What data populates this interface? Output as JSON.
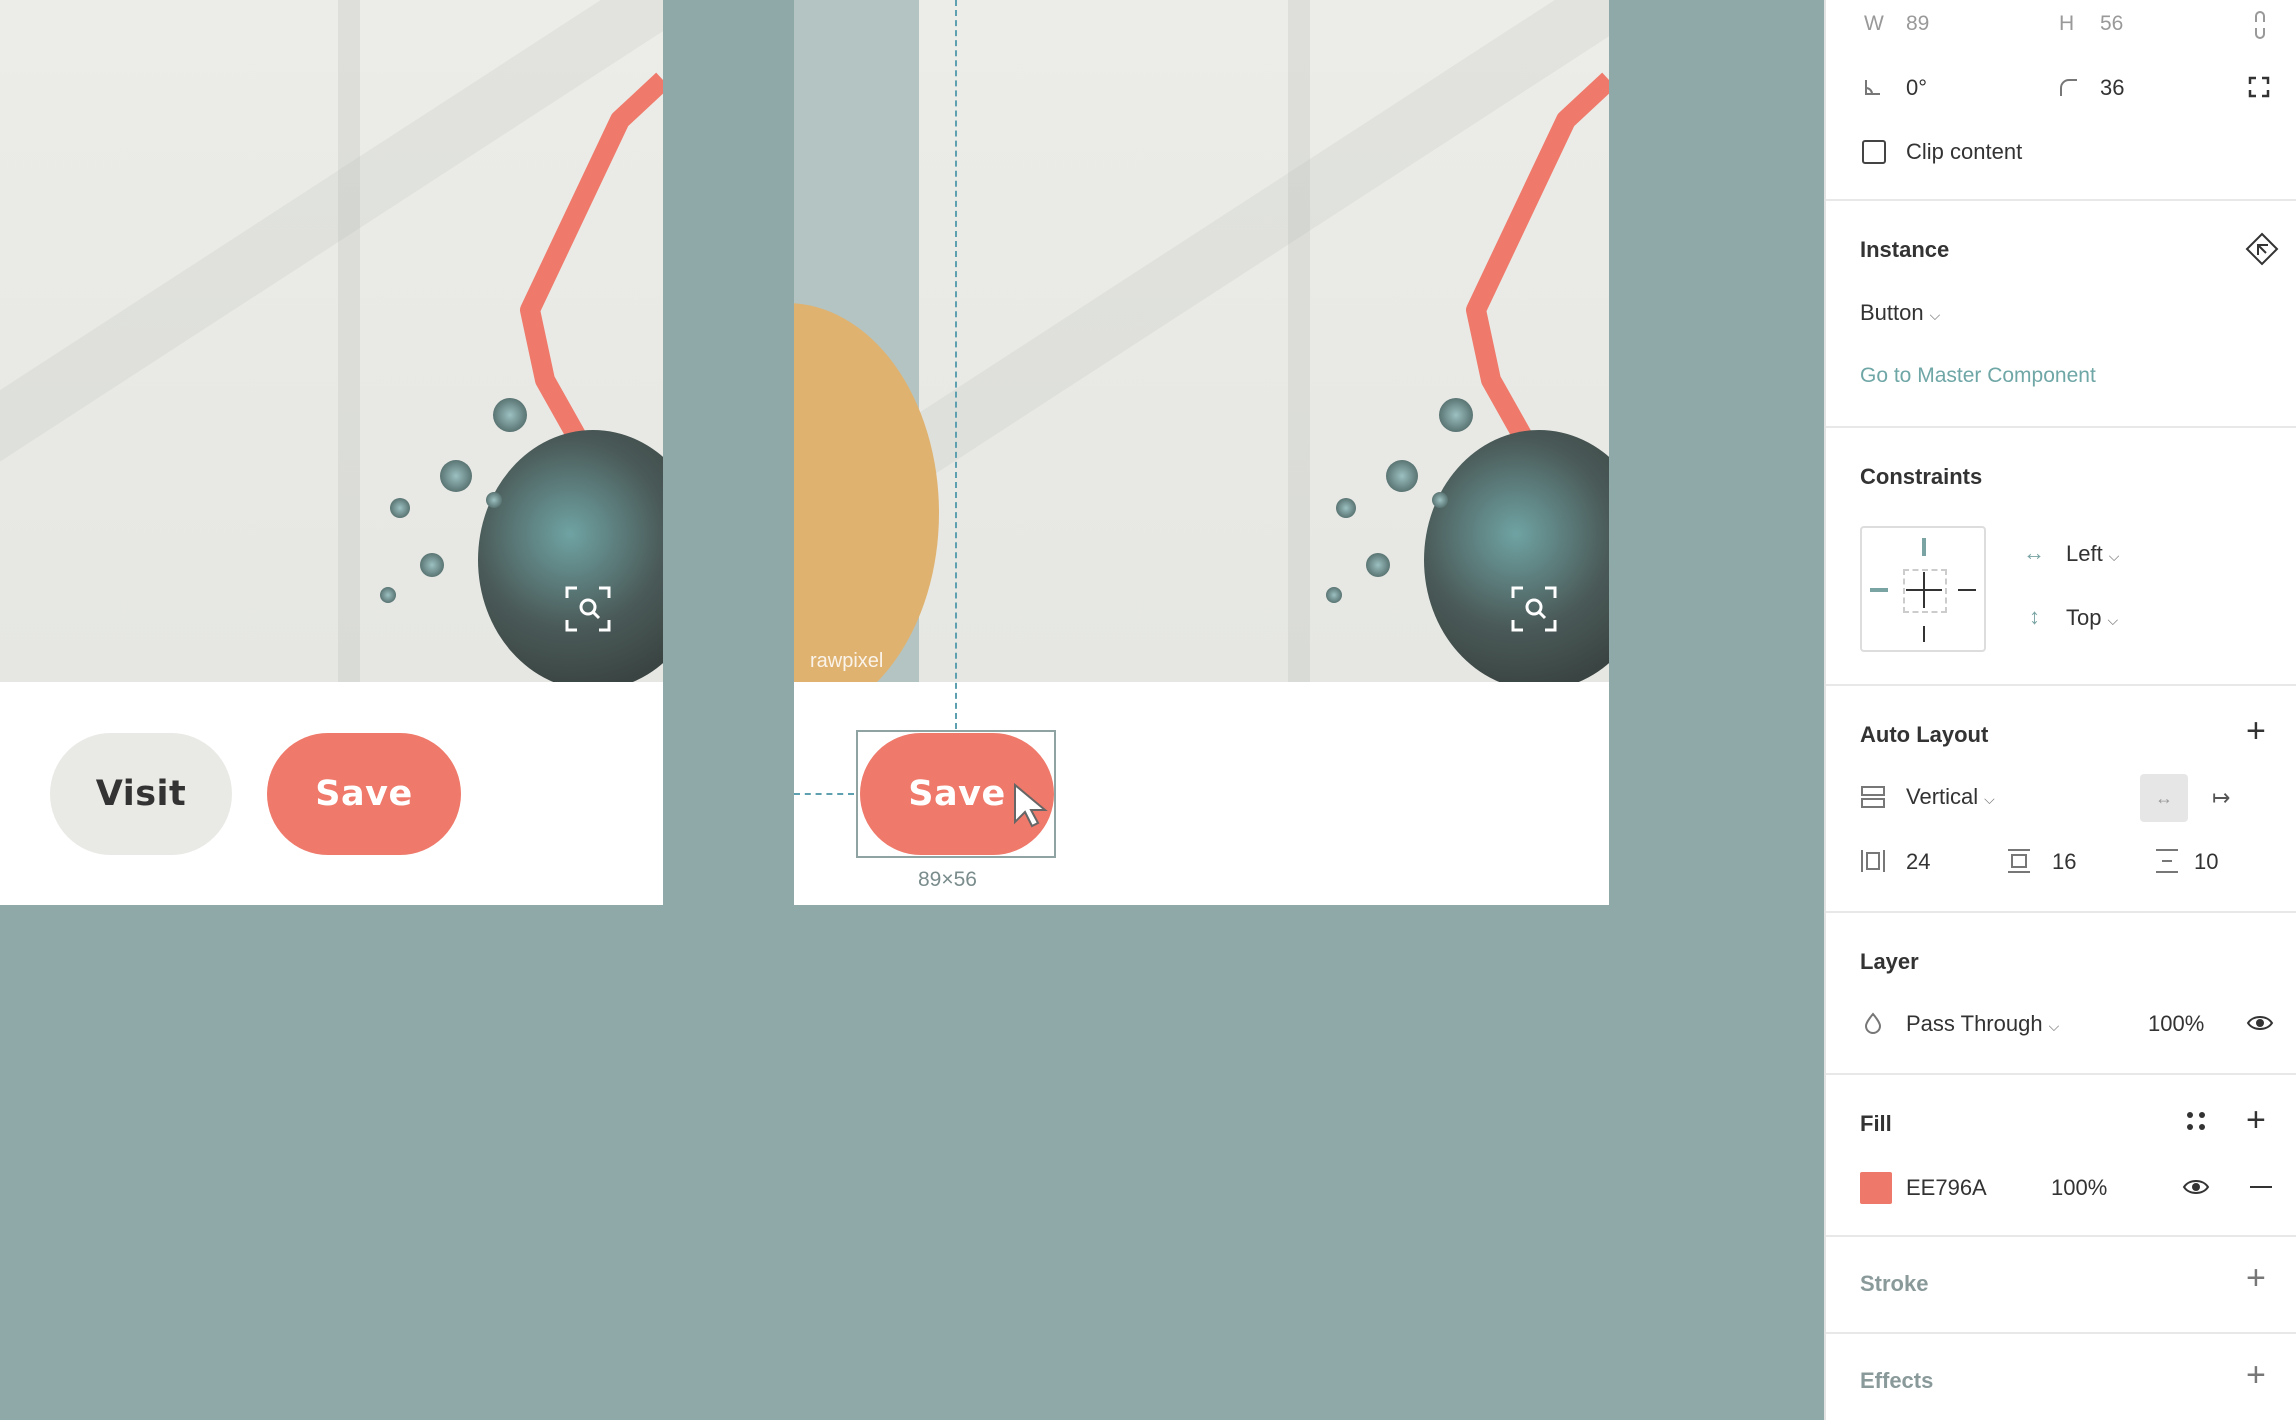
{
  "canvas": {
    "frame_left": {
      "buttons": {
        "visit": "Visit",
        "save": "Save"
      }
    },
    "frame_right": {
      "watermark": "rawpixel",
      "save_button": "Save",
      "size_label": "89×56"
    }
  },
  "panel": {
    "dimensions": {
      "w_label": "W",
      "w_value": "89",
      "h_label": "H",
      "h_value": "56",
      "rotation": "0°",
      "radius": "36"
    },
    "clip_content": {
      "label": "Clip content",
      "checked": false
    },
    "instance": {
      "title": "Instance",
      "component": "Button",
      "master_link": "Go to Master Component"
    },
    "constraints": {
      "title": "Constraints",
      "horizontal": "Left",
      "vertical": "Top"
    },
    "auto_layout": {
      "title": "Auto Layout",
      "direction": "Vertical",
      "padding_h": "24",
      "padding_v": "16",
      "spacing": "10"
    },
    "layer": {
      "title": "Layer",
      "blend": "Pass Through",
      "opacity": "100%"
    },
    "fill": {
      "title": "Fill",
      "hex": "EE796A",
      "opacity": "100%",
      "swatch_color": "#EE796A"
    },
    "stroke": {
      "title": "Stroke"
    },
    "effects": {
      "title": "Effects"
    }
  },
  "colors": {
    "canvas_bg": "#8FA9A9",
    "accent": "#EE796A",
    "link": "#6FA6A6"
  }
}
